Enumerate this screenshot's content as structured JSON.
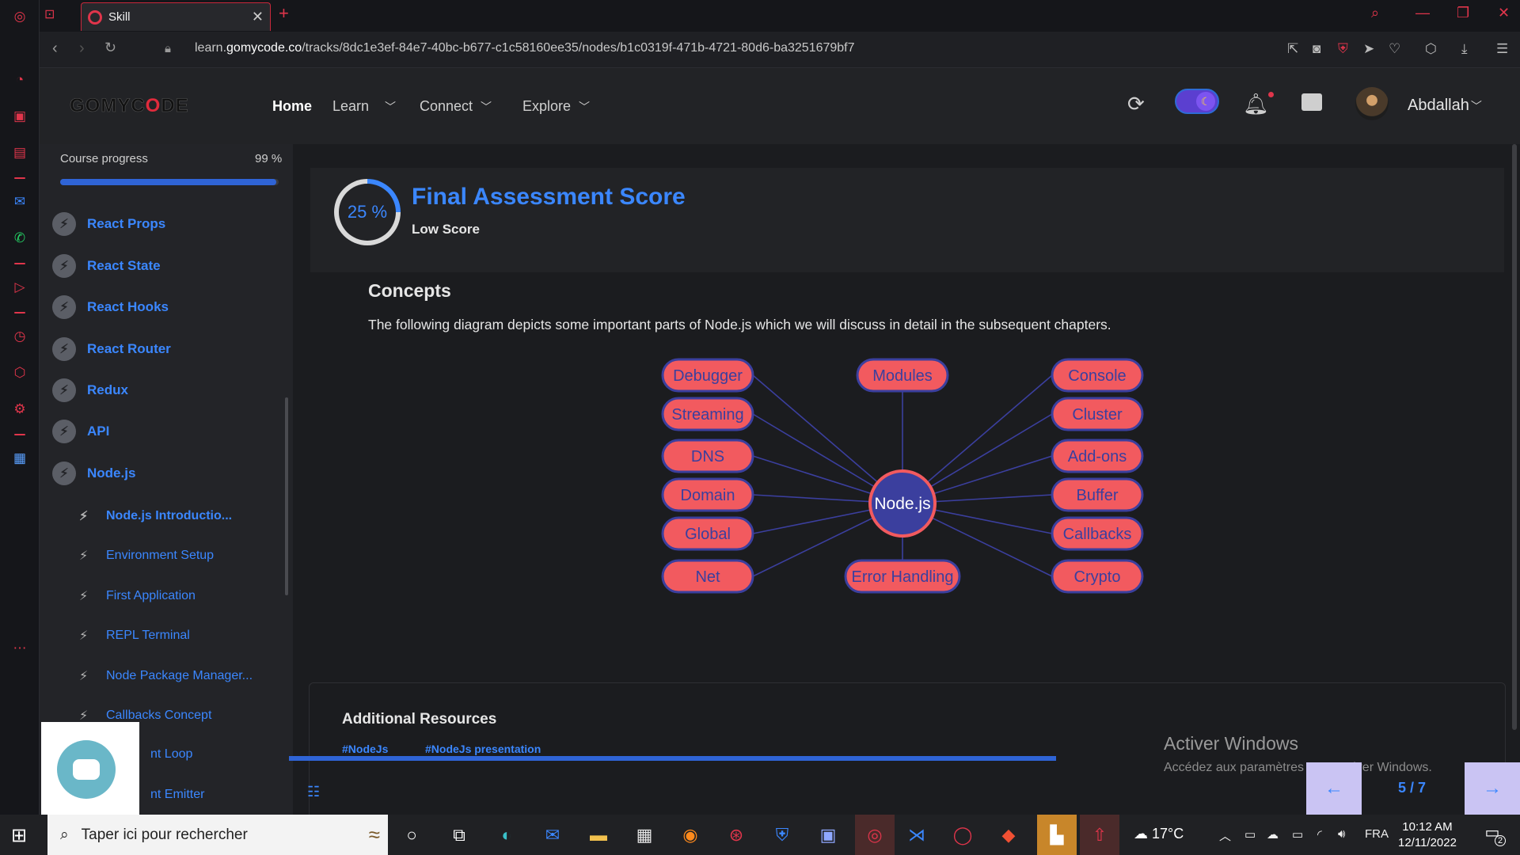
{
  "browser": {
    "tab_title": "Skill",
    "url_prefix": "learn.",
    "url_domain": "gomycode.co",
    "url_path": "/tracks/8dc1e3ef-84e7-40bc-b677-c1c58160ee35/nodes/b1c0319f-471b-4721-80d6-ba3251679bf7"
  },
  "header": {
    "logo_part1": "GOMYC",
    "logo_o": "O",
    "logo_part2": "DE",
    "nav": [
      {
        "label": "Home"
      },
      {
        "label": "Learn"
      },
      {
        "label": "Connect"
      },
      {
        "label": "Explore"
      }
    ],
    "username": "Abdallah"
  },
  "sidebar": {
    "progress_label": "Course progress",
    "progress_value": "99 %",
    "progress_fraction": 0.99,
    "lessons": [
      {
        "label": "React Props"
      },
      {
        "label": "React State"
      },
      {
        "label": "React Hooks"
      },
      {
        "label": "React Router"
      },
      {
        "label": "Redux"
      },
      {
        "label": "API"
      },
      {
        "label": "Node.js"
      }
    ],
    "sublessons": [
      {
        "label": "Node.js Introductio..."
      },
      {
        "label": "Environment Setup"
      },
      {
        "label": "First Application"
      },
      {
        "label": "REPL Terminal"
      },
      {
        "label": "Node Package Manager..."
      },
      {
        "label": "Callbacks Concept"
      },
      {
        "label": "nt Loop"
      },
      {
        "label": "nt Emitter"
      }
    ]
  },
  "main": {
    "score_value": "25 %",
    "score_fraction": 0.25,
    "score_title": "Final Assessment Score",
    "score_sub": "Low Score",
    "concepts_title": "Concepts",
    "concepts_text": "The following diagram depicts some important parts of Node.js which we will discuss in detail in the subsequent chapters.",
    "diagram": {
      "center": "Node.js",
      "left": [
        "Debugger",
        "Streaming",
        "DNS",
        "Domain",
        "Global",
        "Net"
      ],
      "right": [
        "Console",
        "Cluster",
        "Add-ons",
        "Buffer",
        "Callbacks",
        "Crypto"
      ],
      "top": "Modules",
      "bottom": "Error Handling",
      "node_fill": "#f25a5f",
      "node_border": "#3b3f9e",
      "center_fill": "#3b3f9e"
    },
    "resources_title": "Additional Resources",
    "tags": [
      "#NodeJs",
      "#NodeJs presentation"
    ],
    "pager": "5 / 7"
  },
  "watermark": {
    "line1": "Activer Windows",
    "line2": "Accédez aux paramètres pour activer Windows."
  },
  "taskbar": {
    "search_placeholder": "Taper ici pour rechercher",
    "weather": "17°C",
    "lang": "FRA",
    "time": "10:12 AM",
    "date": "12/11/2022",
    "notif_count": "2"
  },
  "colors": {
    "accent": "#3b87ff",
    "progress": "#2f64d6",
    "opera_red": "#e0354b"
  }
}
